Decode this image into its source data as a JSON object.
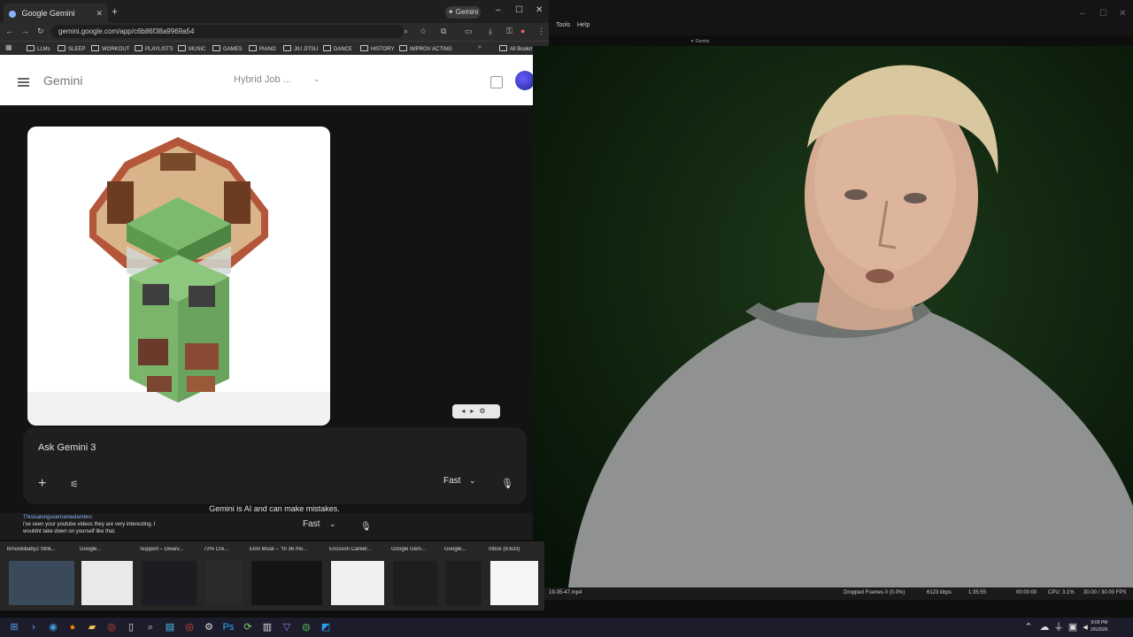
{
  "browser": {
    "tab_title": "Google Gemini",
    "new_tab": "+",
    "gemini_pill": "✦ Gemini",
    "url": "gemini.google.com/app/c6b86f38a9969a54",
    "bookmarks": [
      "LLMs",
      "SLEEP",
      "WORKOUT",
      "PLAYLISTS",
      "MUSIC",
      "GAMES",
      "PIANO",
      "JIU JITSU",
      "DANCE",
      "HISTORY",
      "IMPROV ACTING"
    ],
    "all_bookmarks": "All Bookm",
    "controls": {
      "minimize": "–",
      "maximize": "☐",
      "close": "✕"
    }
  },
  "gemini": {
    "title": "Gemini",
    "chat_title": "Hybrid Job ...",
    "input_placeholder": "Ask Gemini 3",
    "mode": "Fast",
    "disclaimer": "Gemini is AI and can make mistakes."
  },
  "obs": {
    "menu_tools": "Tools",
    "menu_help": "Help",
    "mini_title": "✦ Gemini",
    "filename": "19-35-47.mp4",
    "dropped": "Dropped Frames 0 (0.0%)",
    "bitrate": "6123 kbps",
    "rec_time": "1:35:55",
    "stream_time": "00:00:00",
    "cpu": "CPU: 3.1%",
    "fps": "30.00 / 30.00 FPS"
  },
  "chat_overlay": {
    "user": "Thisisalongusernamedambro:",
    "message": "i've seen your youtube videos they are very interesting. I wouldnt take down on yourself like that.",
    "mode": "Fast"
  },
  "previews": [
    {
      "label": "brnookibaby2 Strik..."
    },
    {
      "label": "Google..."
    },
    {
      "label": "Support – Dwarv..."
    },
    {
      "label": "72% Cre..."
    },
    {
      "label": "Elon Musk – \"In 36 mo..."
    },
    {
      "label": "Ericsson Career..."
    },
    {
      "label": "Google Gem..."
    },
    {
      "label": "Google..."
    },
    {
      "label": "Inbox (9,633)"
    }
  ],
  "taskbar": {
    "clock_time": "8:09 PM",
    "clock_date": "2/6/2026"
  }
}
